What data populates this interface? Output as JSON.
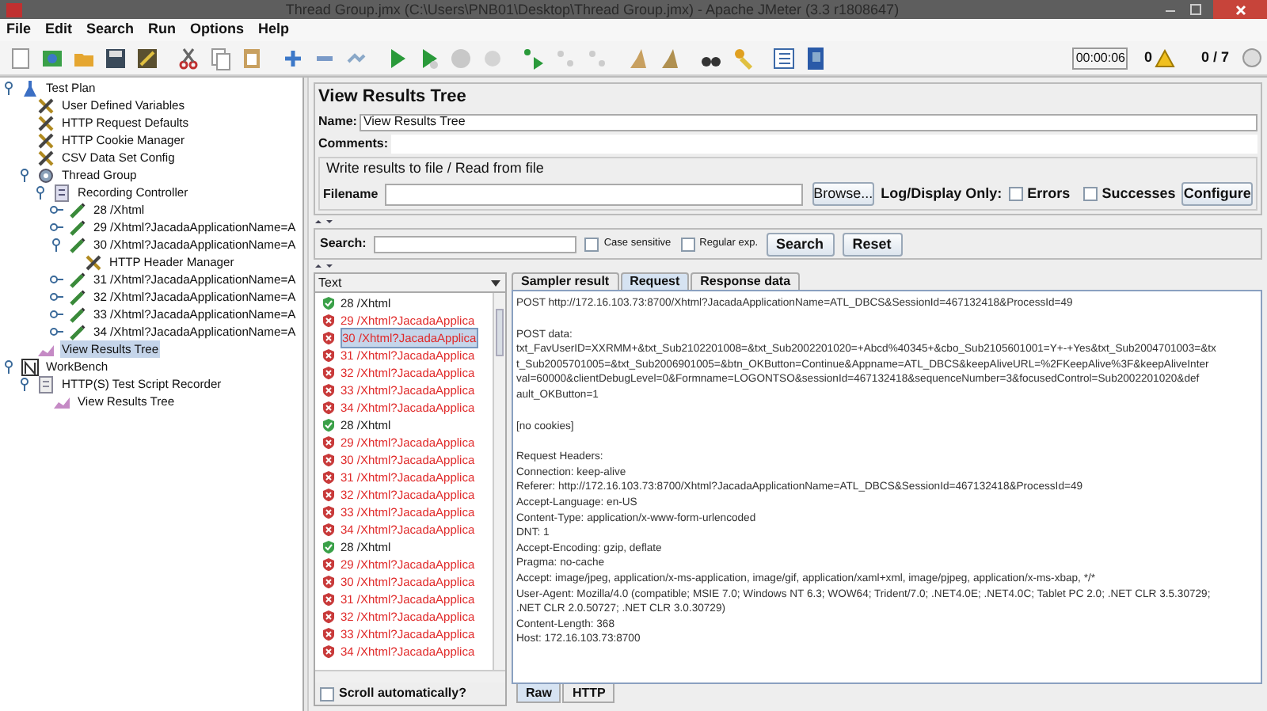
{
  "window": {
    "title": "Thread Group.jmx (C:\\Users\\PNB01\\Desktop\\Thread Group.jmx) - Apache JMeter (3.3 r1808647)"
  },
  "menu": [
    "File",
    "Edit",
    "Search",
    "Run",
    "Options",
    "Help"
  ],
  "toolbar_status": {
    "timer": "00:00:06",
    "warnings": "0",
    "threads": "0 / 7"
  },
  "tree": [
    {
      "label": "Test Plan",
      "kind": "plan",
      "expanded": true,
      "selected": false,
      "children": [
        {
          "label": "User Defined Variables",
          "kind": "config",
          "selected": false
        },
        {
          "label": "HTTP Request Defaults",
          "kind": "config",
          "selected": false
        },
        {
          "label": "HTTP Cookie Manager",
          "kind": "config",
          "selected": false
        },
        {
          "label": "CSV Data Set Config",
          "kind": "config",
          "selected": false
        },
        {
          "label": "Thread Group",
          "kind": "threads",
          "expanded": true,
          "selected": false,
          "children": [
            {
              "label": "Recording Controller",
              "kind": "controller",
              "expanded": true,
              "selected": false,
              "children": [
                {
                  "label": "28 /Xhtml",
                  "kind": "sampler",
                  "expanded": false,
                  "selected": false
                },
                {
                  "label": "29 /Xhtml?JacadaApplicationName=A",
                  "kind": "sampler",
                  "expanded": false,
                  "selected": false
                },
                {
                  "label": "30 /Xhtml?JacadaApplicationName=A",
                  "kind": "sampler",
                  "expanded": true,
                  "selected": false,
                  "children": [
                    {
                      "label": "HTTP Header Manager",
                      "kind": "config",
                      "selected": false
                    }
                  ]
                },
                {
                  "label": "31 /Xhtml?JacadaApplicationName=A",
                  "kind": "sampler",
                  "expanded": false,
                  "selected": false
                },
                {
                  "label": "32 /Xhtml?JacadaApplicationName=A",
                  "kind": "sampler",
                  "expanded": false,
                  "selected": false
                },
                {
                  "label": "33 /Xhtml?JacadaApplicationName=A",
                  "kind": "sampler",
                  "expanded": false,
                  "selected": false
                },
                {
                  "label": "34 /Xhtml?JacadaApplicationName=A",
                  "kind": "sampler",
                  "expanded": false,
                  "selected": false
                }
              ]
            }
          ]
        },
        {
          "label": "View Results Tree",
          "kind": "listener",
          "selected": true
        }
      ]
    },
    {
      "label": "WorkBench",
      "kind": "workbench",
      "expanded": true,
      "selected": false,
      "children": [
        {
          "label": "HTTP(S) Test Script Recorder",
          "kind": "recorder",
          "expanded": true,
          "selected": false,
          "children": [
            {
              "label": "View Results Tree",
              "kind": "listener",
              "selected": false
            }
          ]
        }
      ]
    }
  ],
  "panel": {
    "title": "View Results Tree",
    "name_label": "Name:",
    "name_value": "View Results Tree",
    "comments_label": "Comments:",
    "file_group": {
      "legend": "Write results to file / Read from file",
      "filename_label": "Filename",
      "browse": "Browse...",
      "log_label": "Log/Display Only:",
      "errors": {
        "label": "Errors",
        "checked": false
      },
      "successes": {
        "label": "Successes",
        "checked": false
      },
      "configure": "Configure"
    },
    "search": {
      "label": "Search:",
      "case_sensitive": {
        "label": "Case sensitive",
        "checked": false
      },
      "regular_exp": {
        "label": "Regular exp.",
        "checked": false
      },
      "search_button": "Search",
      "reset_button": "Reset"
    },
    "renderer": "Text",
    "results": [
      {
        "label": "28 /Xhtml",
        "passed": true,
        "selected": false
      },
      {
        "label": "29 /Xhtml?JacadaApplica",
        "passed": false,
        "selected": false
      },
      {
        "label": "30 /Xhtml?JacadaApplica",
        "passed": false,
        "selected": true
      },
      {
        "label": "31 /Xhtml?JacadaApplica",
        "passed": false,
        "selected": false
      },
      {
        "label": "32 /Xhtml?JacadaApplica",
        "passed": false,
        "selected": false
      },
      {
        "label": "33 /Xhtml?JacadaApplica",
        "passed": false,
        "selected": false
      },
      {
        "label": "34 /Xhtml?JacadaApplica",
        "passed": false,
        "selected": false
      },
      {
        "label": "28 /Xhtml",
        "passed": true,
        "selected": false
      },
      {
        "label": "29 /Xhtml?JacadaApplica",
        "passed": false,
        "selected": false
      },
      {
        "label": "30 /Xhtml?JacadaApplica",
        "passed": false,
        "selected": false
      },
      {
        "label": "31 /Xhtml?JacadaApplica",
        "passed": false,
        "selected": false
      },
      {
        "label": "32 /Xhtml?JacadaApplica",
        "passed": false,
        "selected": false
      },
      {
        "label": "33 /Xhtml?JacadaApplica",
        "passed": false,
        "selected": false
      },
      {
        "label": "34 /Xhtml?JacadaApplica",
        "passed": false,
        "selected": false
      },
      {
        "label": "28 /Xhtml",
        "passed": true,
        "selected": false
      },
      {
        "label": "29 /Xhtml?JacadaApplica",
        "passed": false,
        "selected": false
      },
      {
        "label": "30 /Xhtml?JacadaApplica",
        "passed": false,
        "selected": false
      },
      {
        "label": "31 /Xhtml?JacadaApplica",
        "passed": false,
        "selected": false
      },
      {
        "label": "32 /Xhtml?JacadaApplica",
        "passed": false,
        "selected": false
      },
      {
        "label": "33 /Xhtml?JacadaApplica",
        "passed": false,
        "selected": false
      },
      {
        "label": "34 /Xhtml?JacadaApplica",
        "passed": false,
        "selected": false
      }
    ],
    "scroll_auto": {
      "label": "Scroll automatically?",
      "checked": false
    },
    "tabs": [
      {
        "label": "Sampler result",
        "selected": false
      },
      {
        "label": "Request",
        "selected": true
      },
      {
        "label": "Response data",
        "selected": false
      }
    ],
    "request_paragraphs": [
      [
        "POST http://172.16.103.73:8700/Xhtml?JacadaApplicationName=ATL_DBCS&SessionId=467132418&ProcessId=49"
      ],
      [
        "POST data:",
        "txt_FavUserID=XXRMM+&txt_Sub2102201008=&txt_Sub2002201020=+Abcd%40345+&cbo_Sub2105601001=Y+-+Yes&txt_Sub2004701003=&tx",
        "t_Sub2005701005=&txt_Sub2006901005=&btn_OKButton=Continue&Appname=ATL_DBCS&keepAliveURL=%2FKeepAlive%3F&keepAliveInter",
        "val=60000&clientDebugLevel=0&Formname=LOGONTSO&sessionId=467132418&sequenceNumber=3&focusedControl=Sub2002201020&def",
        "ault_OKButton=1"
      ],
      [
        "[no cookies]"
      ],
      [
        "Request Headers:",
        "Connection: keep-alive",
        "Referer: http://172.16.103.73:8700/Xhtml?JacadaApplicationName=ATL_DBCS&SessionId=467132418&ProcessId=49",
        "Accept-Language: en-US",
        "Content-Type: application/x-www-form-urlencoded",
        "DNT: 1",
        "Accept-Encoding: gzip, deflate",
        "Pragma: no-cache",
        "Accept: image/jpeg, application/x-ms-application, image/gif, application/xaml+xml, image/pjpeg, application/x-ms-xbap, */*",
        "User-Agent: Mozilla/4.0 (compatible; MSIE 7.0; Windows NT 6.3; WOW64; Trident/7.0; .NET4.0E; .NET4.0C; Tablet PC 2.0; .NET CLR 3.5.30729;",
        ".NET CLR 2.0.50727; .NET CLR 3.0.30729)",
        "Content-Length: 368",
        "Host: 172.16.103.73:8700"
      ]
    ],
    "bottom_tabs": [
      {
        "label": "Raw",
        "selected": true
      },
      {
        "label": "HTTP",
        "selected": false
      }
    ]
  }
}
